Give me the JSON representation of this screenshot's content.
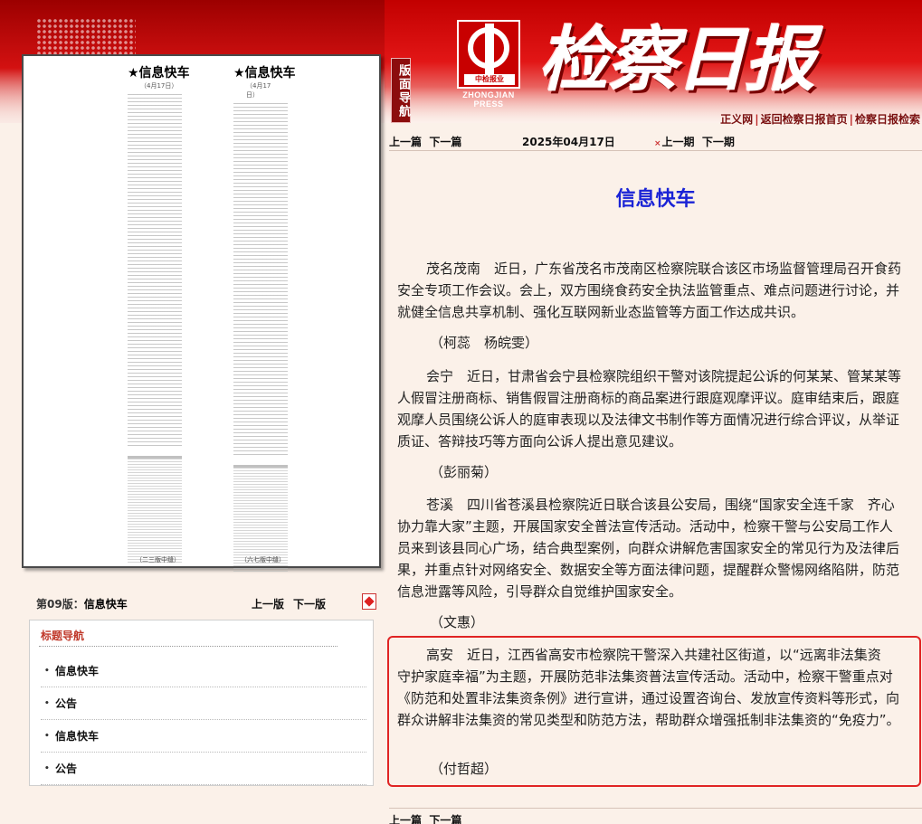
{
  "header": {
    "nav_tab": "版面导航",
    "logo_text": "中检报业",
    "press": "ZHONGJIAN PRESS",
    "masthead": "检察日报",
    "links": [
      "正义网",
      "返回检察日报首页",
      "检察日报检索"
    ]
  },
  "paper_thumb": {
    "col1_title": "★信息快车",
    "col1_date": "（4月17日）",
    "col2_title": "★信息快车",
    "col2_date": "（4月17日）",
    "foot1": "（二三版中缝）",
    "foot2": "（六七版中缝）"
  },
  "edition": {
    "label": "第09版：",
    "title": "信息快车",
    "prev": "上一版",
    "next": "下一版"
  },
  "title_nav": {
    "heading": "标题导航",
    "items": [
      "信息快车",
      "公告",
      "信息快车",
      "公告"
    ]
  },
  "pager": {
    "prev_article": "上一篇",
    "next_article": "下一篇",
    "date": "2025年04月17日",
    "prev_issue": "上一期",
    "next_issue": "下一期"
  },
  "article": {
    "title": "信息快车",
    "paragraphs": [
      "茂名茂南　近日，广东省茂名市茂南区检察院联合该区市场监督管理局召开食药安全专项工作会议。会上，双方围绕食药安全执法监管重点、难点问题进行讨论，并就健全信息共享机制、强化互联网新业态监管等方面工作达成共识。",
      "（柯蕊　杨皖雯）",
      "会宁　近日，甘肃省会宁县检察院组织干警对该院提起公诉的何某某、管某某等人假冒注册商标、销售假冒注册商标的商品案进行跟庭观摩评议。庭审结束后，跟庭观摩人员围绕公诉人的庭审表现以及法律文书制作等方面情况进行综合评议，从举证质证、答辩技巧等方面向公诉人提出意见建议。",
      "（彭丽菊）",
      "苍溪　四川省苍溪县检察院近日联合该县公安局，围绕“国家安全连千家　齐心协力靠大家”主题，开展国家安全普法宣传活动。活动中，检察干警与公安局工作人员来到该县同心广场，结合典型案例，向群众讲解危害国家安全的常见行为及法律后果，并重点针对网络安全、数据安全等方面法律问题，提醒群众警惕网络陷阱，防范信息泄露等风险，引导群众自觉维护国家安全。",
      "（文惠）",
      "高安　近日，江西省高安市检察院干警深入共建社区街道，以“远离非法集资　守护家庭幸福”为主题，开展防范非法集资普法宣传活动。活动中，检察干警重点对《防范和处置非法集资条例》进行宣讲，通过设置咨询台、发放宣传资料等形式，向群众讲解非法集资的常见类型和防范方法，帮助群众增强抵制非法集资的“免疫力”。",
      "（付哲超）"
    ]
  }
}
